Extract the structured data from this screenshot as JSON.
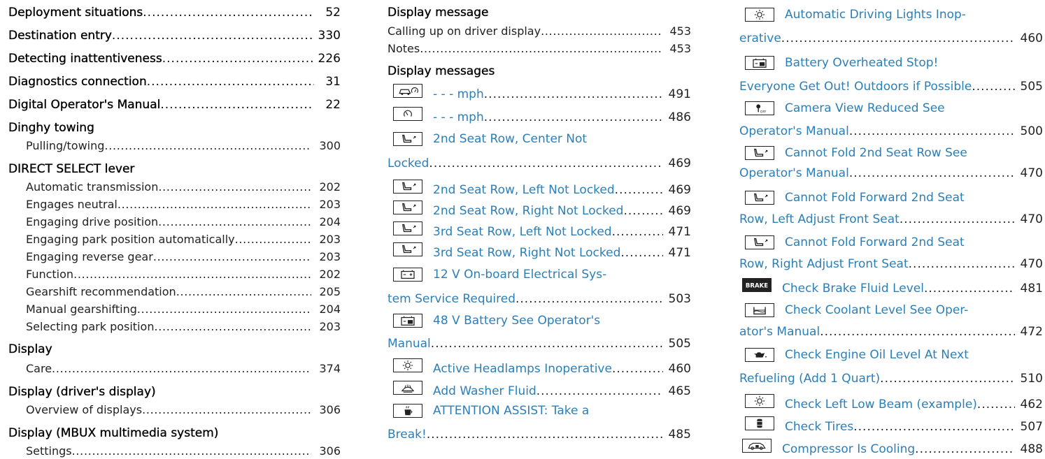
{
  "col1": {
    "entries": [
      {
        "term": "Deployment situations",
        "page": "52"
      },
      {
        "term": "Destination entry",
        "page": "330"
      },
      {
        "term": "Detecting inattentiveness",
        "page": "226"
      },
      {
        "term": "Diagnostics connection",
        "page": "31"
      },
      {
        "term": "Digital Operator's Manual",
        "page": "22"
      },
      {
        "term": "Dinghy towing"
      },
      {
        "sub": "Pulling/towing",
        "page": "300"
      },
      {
        "term": "DIRECT SELECT lever"
      },
      {
        "sub": "Automatic transmission",
        "page": "202"
      },
      {
        "sub": "Engages neutral",
        "page": "203"
      },
      {
        "sub": "Engaging drive position",
        "page": "204"
      },
      {
        "sub": "Engaging park position automatically",
        "page": "203"
      },
      {
        "sub": "Engaging reverse gear",
        "page": "203"
      },
      {
        "sub": "Function",
        "page": "202"
      },
      {
        "sub": "Gearshift recommendation",
        "page": "205"
      },
      {
        "sub": "Manual gearshifting",
        "page": "204"
      },
      {
        "sub": "Selecting park position",
        "page": "203"
      },
      {
        "term": "Display"
      },
      {
        "sub": "Care",
        "page": "374"
      },
      {
        "term": "Display (driver's display)"
      },
      {
        "sub": "Overview of displays",
        "page": "306"
      },
      {
        "term": "Display (MBUX multimedia system)"
      },
      {
        "sub": "Settings",
        "page": "306"
      }
    ]
  },
  "col2": {
    "heading1": "Display message",
    "sub1": [
      {
        "label": "Calling up on driver display",
        "page": "453"
      },
      {
        "label": "Notes",
        "page": "453"
      }
    ],
    "heading2": "Display messages",
    "messages": [
      {
        "icon": "car-speed-icon",
        "text": "- - - mph",
        "page": "491"
      },
      {
        "icon": "speedometer-icon",
        "text": "- - - mph",
        "page": "486"
      },
      {
        "icon": "seat-icon",
        "text": "2nd Seat Row, Center Not",
        "cont": "Locked",
        "page": "469"
      },
      {
        "icon": "seat-icon",
        "text": "2nd Seat Row, Left Not Locked",
        "page": "469"
      },
      {
        "icon": "seat-icon",
        "text": "2nd Seat Row, Right Not Locked",
        "page": "469"
      },
      {
        "icon": "seat-icon",
        "text": "3rd Seat Row, Left Not Locked",
        "page": "471"
      },
      {
        "icon": "seat-icon",
        "text": "3rd Seat Row, Right Not Locked",
        "page": "471"
      },
      {
        "icon": "battery-icon",
        "text": "12 V On-board Electrical Sys-",
        "cont": "tem Service Required",
        "page": "503"
      },
      {
        "icon": "hv-battery-icon",
        "text": "48 V Battery See Operator's",
        "cont": "Manual",
        "page": "505"
      },
      {
        "icon": "headlamp-icon",
        "text": "Active Headlamps Inoperative",
        "page": "460"
      },
      {
        "icon": "washer-fluid-icon",
        "text": "Add Washer Fluid",
        "page": "465"
      },
      {
        "icon": "coffee-cup-icon",
        "text": "ATTENTION ASSIST: Take a",
        "cont": "Break!",
        "page": "485"
      }
    ]
  },
  "col3": {
    "messages": [
      {
        "icon": "headlamp-icon",
        "text": "Automatic Driving Lights Inop-",
        "cont": "erative",
        "page": "460"
      },
      {
        "icon": "hv-battery-icon",
        "text": "Battery Overheated Stop!",
        "cont": "Everyone Get Out! Outdoors if Possible",
        "page": "505"
      },
      {
        "icon": "camera-off-icon",
        "text": "Camera View Reduced See",
        "cont": "Operator's Manual",
        "page": "500"
      },
      {
        "icon": "seat-icon",
        "text": "Cannot Fold 2nd Seat Row See",
        "cont": "Operator's Manual",
        "page": "470"
      },
      {
        "icon": "seat-icon",
        "text": "Cannot Fold Forward 2nd Seat",
        "cont": "Row, Left Adjust Front Seat",
        "page": "470"
      },
      {
        "icon": "seat-icon",
        "text": "Cannot Fold Forward 2nd Seat",
        "cont": "Row, Right Adjust Front Seat",
        "page": "470"
      },
      {
        "icon": "brake-icon",
        "iconText": "BRAKE",
        "text": "Check Brake Fluid Level",
        "page": "481"
      },
      {
        "icon": "coolant-icon",
        "text": "Check Coolant Level See Oper-",
        "cont": "ator's Manual",
        "page": "472"
      },
      {
        "icon": "oil-can-icon",
        "text": "Check Engine Oil Level At Next",
        "cont": "Refueling (Add 1 Quart)",
        "page": "510"
      },
      {
        "icon": "headlamp-icon",
        "text": "Check Left Low Beam (example)",
        "page": "462"
      },
      {
        "icon": "tire-icon",
        "text": "Check Tires",
        "page": "507"
      },
      {
        "icon": "compressor-icon",
        "text": "Compressor Is Cooling",
        "page": "488"
      }
    ]
  }
}
